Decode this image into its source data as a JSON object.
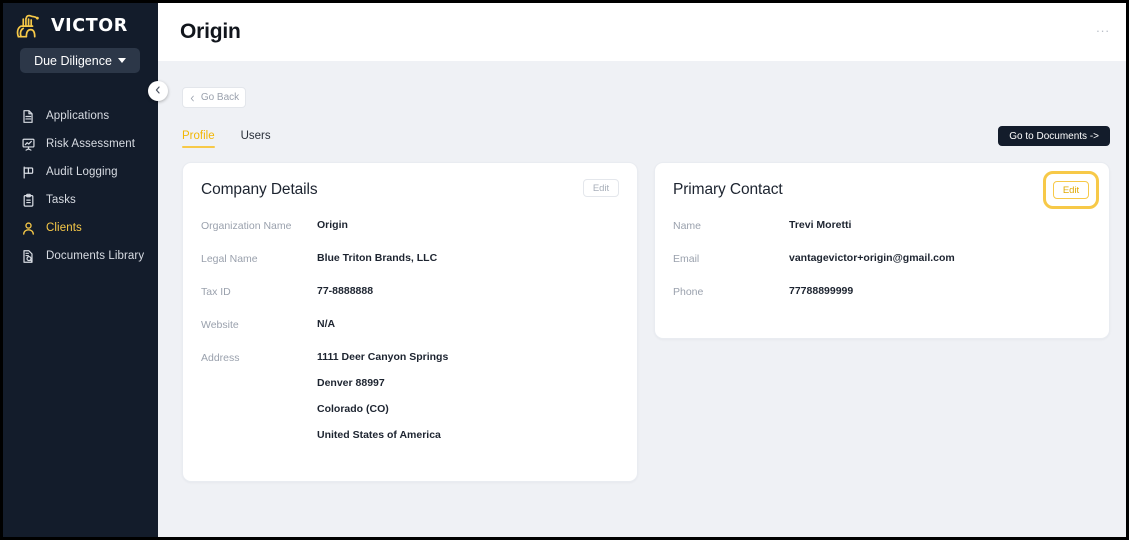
{
  "brand": {
    "name": "VICTOR",
    "logo_icon": "victor-emblem-icon",
    "accent_color": "#f7c948"
  },
  "sidebar": {
    "workspace": {
      "label": "Due Diligence",
      "caret_icon": "chevron-down-icon"
    },
    "collapse_icon": "chevron-left-icon",
    "items": [
      {
        "label": "Applications",
        "icon": "document-icon",
        "active": false
      },
      {
        "label": "Risk Assessment",
        "icon": "presentation-chart-icon",
        "active": false
      },
      {
        "label": "Audit Logging",
        "icon": "flag-icon",
        "active": false
      },
      {
        "label": "Tasks",
        "icon": "clipboard-icon",
        "active": false
      },
      {
        "label": "Clients",
        "icon": "user-icon",
        "active": true
      },
      {
        "label": "Documents Library",
        "icon": "document-search-icon",
        "active": false
      }
    ]
  },
  "topbar": {
    "title": "Origin",
    "overflow_menu": "...",
    "overflow_icon": "ellipsis-horizontal-icon"
  },
  "toolbar": {
    "go_back_label": "Go Back",
    "go_back_icon": "chevron-left-icon",
    "documents_button_label": "Go to Documents ->"
  },
  "tabs": [
    {
      "label": "Profile",
      "active": true
    },
    {
      "label": "Users",
      "active": false
    }
  ],
  "cards": {
    "company_details": {
      "title": "Company Details",
      "edit_label": "Edit",
      "edit_highlighted": false,
      "fields": [
        {
          "label": "Organization Name",
          "value": "Origin"
        },
        {
          "label": "Legal Name",
          "value": "Blue Triton Brands, LLC"
        },
        {
          "label": "Tax ID",
          "value": "77-8888888"
        },
        {
          "label": "Website",
          "value": "N/A"
        }
      ],
      "address": {
        "label": "Address",
        "lines": [
          "1111 Deer Canyon Springs",
          "Denver 88997",
          "Colorado (CO)",
          "United States of America"
        ]
      }
    },
    "primary_contact": {
      "title": "Primary Contact",
      "edit_label": "Edit",
      "edit_highlighted": true,
      "highlight_color": "#f7c948",
      "fields": [
        {
          "label": "Name",
          "value": "Trevi Moretti"
        },
        {
          "label": "Email",
          "value": "vantagevictor+origin@gmail.com"
        },
        {
          "label": "Phone",
          "value": "77788899999"
        }
      ]
    }
  }
}
